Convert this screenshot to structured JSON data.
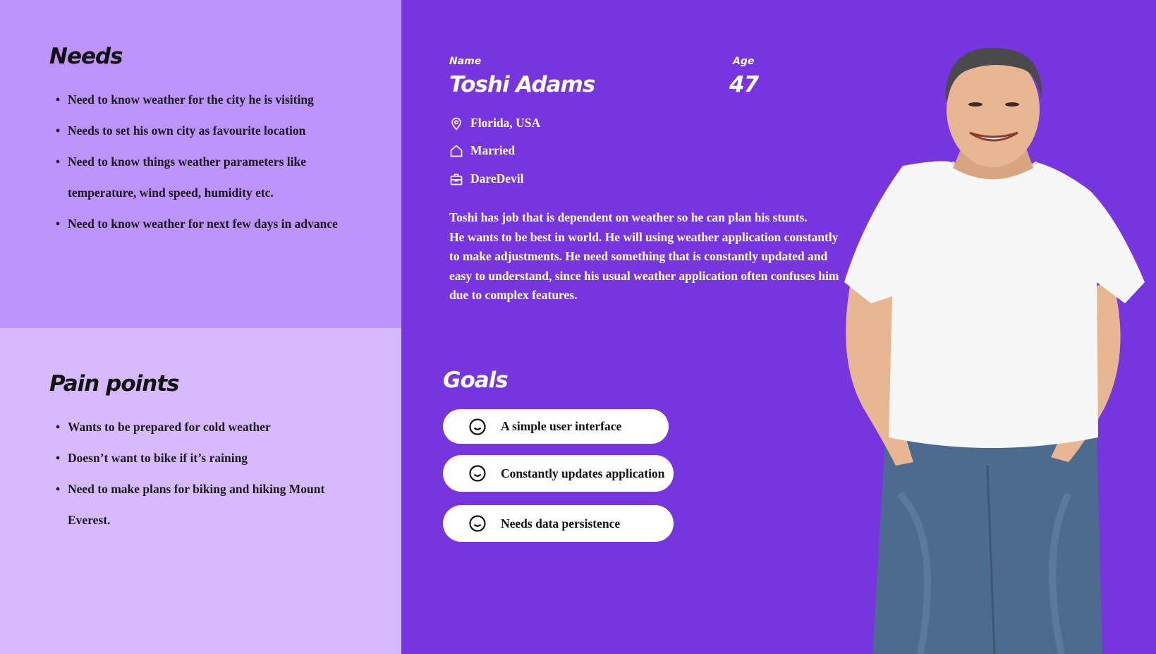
{
  "needs": {
    "title": "Needs",
    "items": [
      "Need to know weather for the city he is visiting",
      "Needs to set his own city as favourite location",
      "Need to know things weather parameters like temperature, wind speed, humidity etc.",
      "Need to know weather for next few days in advance"
    ]
  },
  "pain_points": {
    "title": "Pain points",
    "items": [
      "Wants to be prepared for cold weather",
      "Doesn’t want to bike if it’s raining",
      "Need to make plans for biking and hiking Mount Everest."
    ]
  },
  "profile": {
    "name_label": "Name",
    "name": "Toshi Adams",
    "age_label": "Age",
    "age": "47",
    "location": "Florida, USA",
    "relationship": "Married",
    "occupation": "DareDevil",
    "bio_line1": "Toshi has job that is dependent on weather so he can plan his stunts.",
    "bio_line2": "He wants to be best in world. He will using weather application constantly to make adjustments. He need something that is constantly updated and easy to understand, since his usual weather application often confuses him due to complex features."
  },
  "goals": {
    "title": "Goals",
    "items": [
      "A simple user interface",
      "Constantly updates application",
      "Needs data persistence"
    ]
  },
  "icons": {
    "location": "location-pin-icon",
    "home": "home-icon",
    "work": "briefcase-icon",
    "goal": "smile-icon"
  },
  "colors": {
    "needs_bg": "#bd93fc",
    "pain_bg": "#d6bafd",
    "main_bg": "#7735df",
    "pill_bg": "#ffffff"
  }
}
